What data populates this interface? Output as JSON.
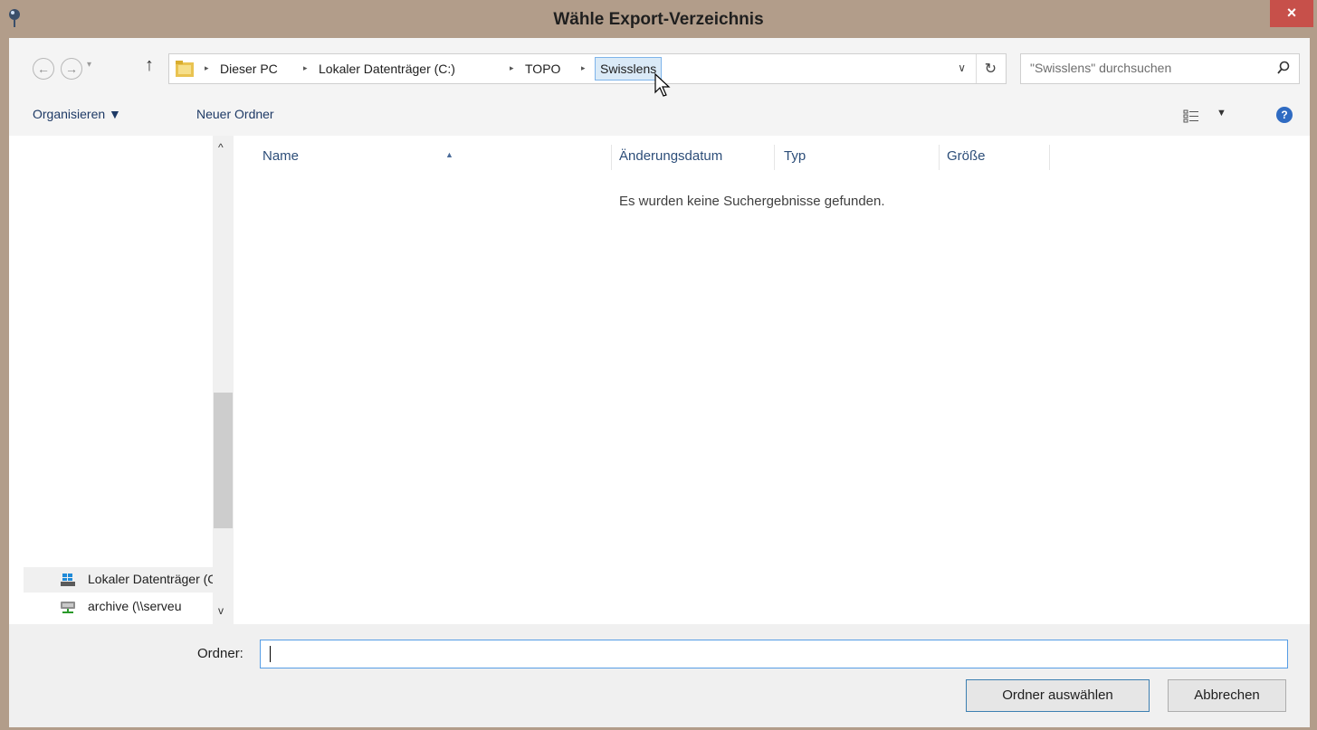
{
  "window": {
    "title": "Wähle Export-Verzeichnis",
    "close_label": "×"
  },
  "nav": {
    "back_icon": "←",
    "forward_icon": "→",
    "dropdown_icon": "▾",
    "up_icon": "↑"
  },
  "address": {
    "crumbs": [
      "Dieser PC",
      "Lokaler Datenträger (C:)",
      "TOPO",
      "Swisslens"
    ],
    "separator": "▸",
    "dropdown": "∨",
    "refresh": "↻"
  },
  "search": {
    "placeholder": "\"Swisslens\" durchsuchen"
  },
  "toolbar": {
    "organize_label": "Organisieren ▼",
    "new_folder_label": "Neuer Ordner",
    "view_dropdown": "▼",
    "help_label": "?"
  },
  "nav_pane": {
    "scroll_up": "^",
    "scroll_down": "v",
    "items": [
      {
        "label": "Lokaler Datenträger (C:)",
        "icon": "drive-icon"
      },
      {
        "label": "archive (\\\\serveu",
        "icon": "network-drive-icon"
      }
    ]
  },
  "columns": [
    "Name",
    "Änderungsdatum",
    "Typ",
    "Größe"
  ],
  "empty_message": "Es wurden keine Suchergebnisse gefunden.",
  "footer": {
    "folder_label": "Ordner:",
    "folder_value": "",
    "select_label": "Ordner auswählen",
    "cancel_label": "Abbrechen"
  }
}
